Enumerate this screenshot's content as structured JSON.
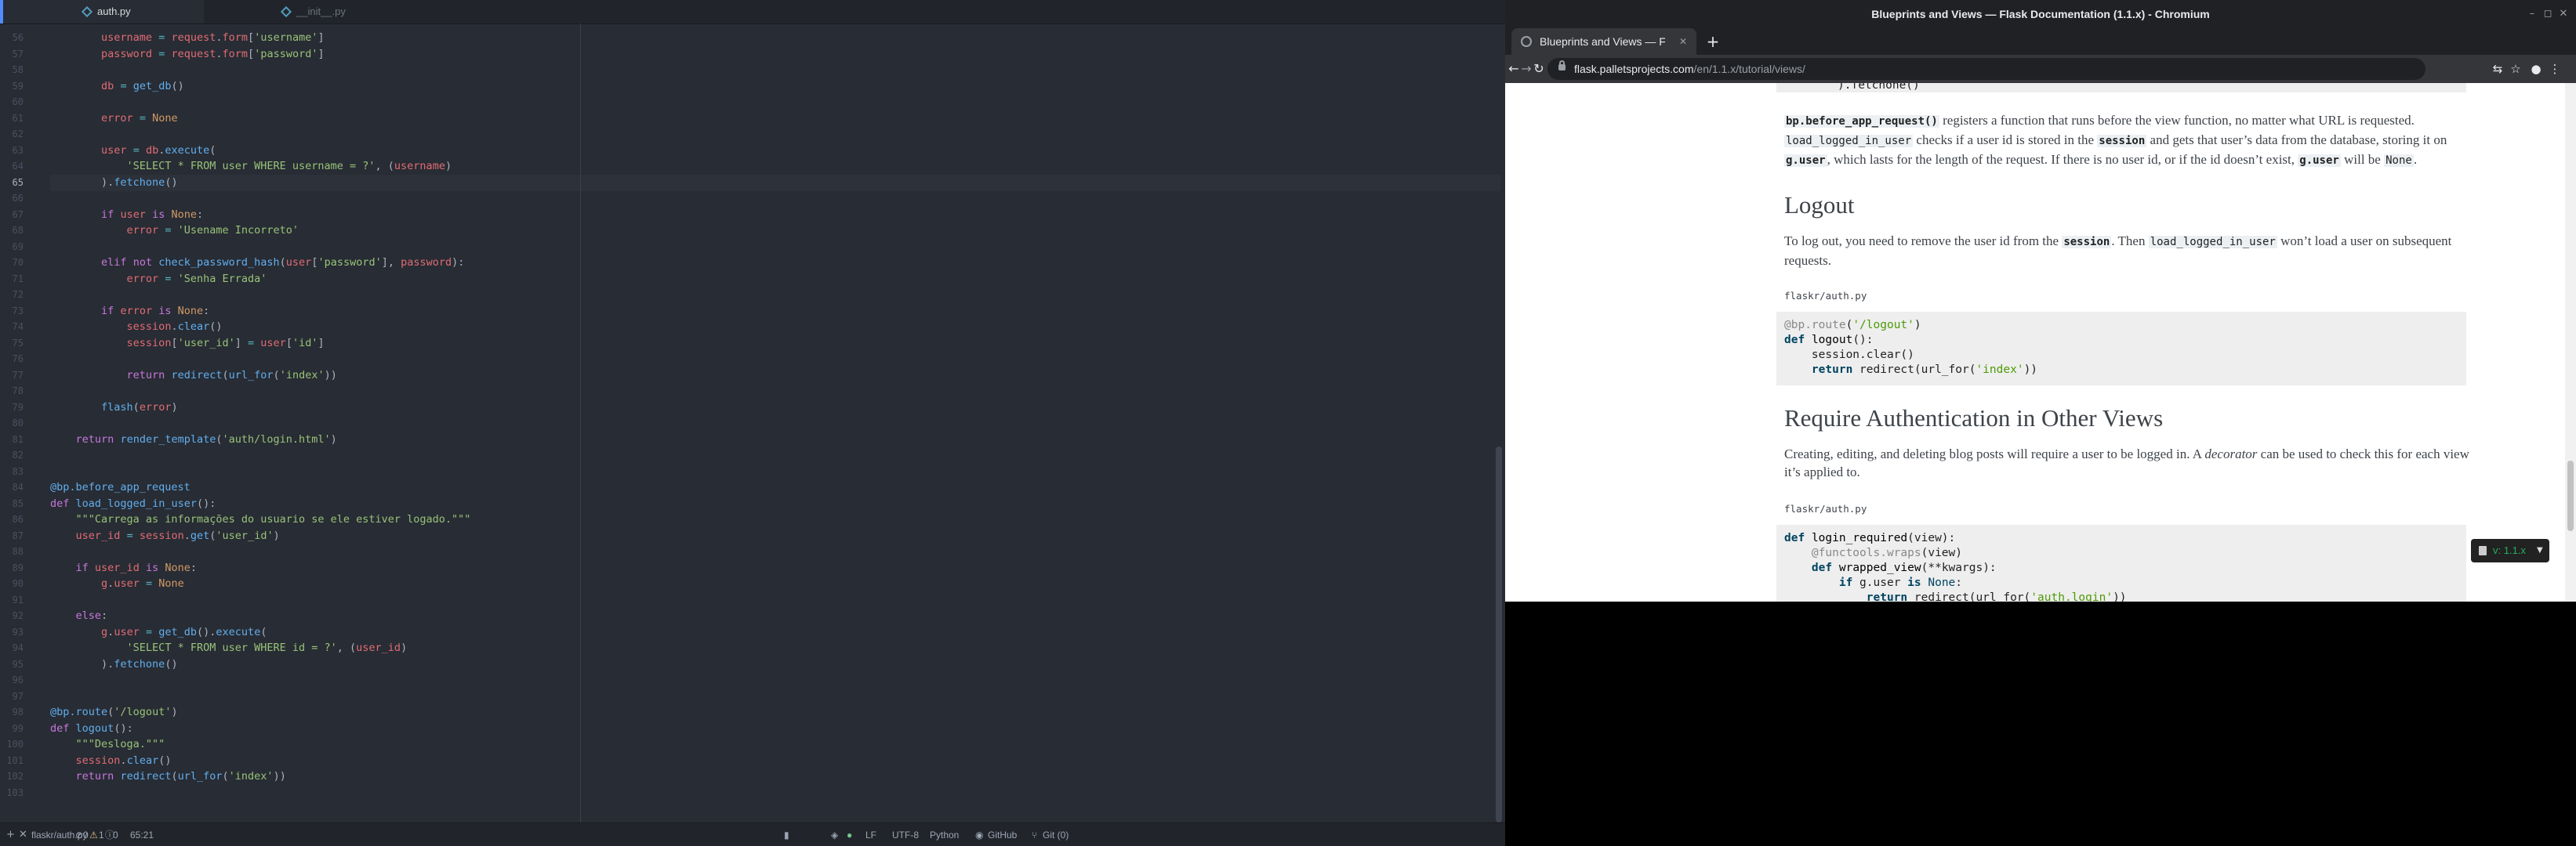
{
  "editor": {
    "tabs": [
      {
        "label": "auth.py",
        "active": true
      },
      {
        "label": "__init__.py",
        "active": false
      }
    ],
    "lines": [
      {
        "n": "56",
        "html": "        <span class=\"v\">username</span> <span class=\"o\">=</span> <span class=\"v\">request</span>.<span class=\"v\">form</span>[<span class=\"s\">'username'</span>]"
      },
      {
        "n": "57",
        "html": "        <span class=\"v\">password</span> <span class=\"o\">=</span> <span class=\"v\">request</span>.<span class=\"v\">form</span>[<span class=\"s\">'password'</span>]"
      },
      {
        "n": "58",
        "html": ""
      },
      {
        "n": "59",
        "html": "        <span class=\"v\">db</span> <span class=\"o\">=</span> <span class=\"f\">get_db</span>()"
      },
      {
        "n": "60",
        "html": ""
      },
      {
        "n": "61",
        "html": "        <span class=\"v\">error</span> <span class=\"o\">=</span> <span class=\"n\">None</span>"
      },
      {
        "n": "62",
        "html": ""
      },
      {
        "n": "63",
        "html": "        <span class=\"v\">user</span> <span class=\"o\">=</span> <span class=\"v\">db</span>.<span class=\"f\">execute</span>("
      },
      {
        "n": "64",
        "html": "            <span class=\"s\">'SELECT * FROM user WHERE username = ?'</span>, (<span class=\"v\">username</span>)"
      },
      {
        "n": "65",
        "html": "        ).<span class=\"f\">fetchone</span>()"
      },
      {
        "n": "66",
        "html": ""
      },
      {
        "n": "67",
        "html": "        <span class=\"k\">if</span> <span class=\"v\">user</span> <span class=\"k\">is</span> <span class=\"n\">None</span>:"
      },
      {
        "n": "68",
        "html": "            <span class=\"v\">error</span> <span class=\"o\">=</span> <span class=\"s\">'Usename Incorreto'</span>"
      },
      {
        "n": "69",
        "html": ""
      },
      {
        "n": "70",
        "html": "        <span class=\"k\">elif</span> <span class=\"k\">not</span> <span class=\"f\">check_password_hash</span>(<span class=\"v\">user</span>[<span class=\"s\">'password'</span>], <span class=\"v\">password</span>):"
      },
      {
        "n": "71",
        "html": "            <span class=\"v\">error</span> <span class=\"o\">=</span> <span class=\"s\">'Senha Errada'</span>"
      },
      {
        "n": "72",
        "html": ""
      },
      {
        "n": "73",
        "html": "        <span class=\"k\">if</span> <span class=\"v\">error</span> <span class=\"k\">is</span> <span class=\"n\">None</span>:"
      },
      {
        "n": "74",
        "html": "            <span class=\"v\">session</span>.<span class=\"f\">clear</span>()"
      },
      {
        "n": "75",
        "html": "            <span class=\"v\">session</span>[<span class=\"s\">'user_id'</span>] <span class=\"o\">=</span> <span class=\"v\">user</span>[<span class=\"s\">'id'</span>]"
      },
      {
        "n": "76",
        "html": ""
      },
      {
        "n": "77",
        "html": "            <span class=\"k\">return</span> <span class=\"f\">redirect</span>(<span class=\"f\">url_for</span>(<span class=\"s\">'index'</span>))"
      },
      {
        "n": "78",
        "html": ""
      },
      {
        "n": "79",
        "html": "        <span class=\"f\">flash</span>(<span class=\"v\">error</span>)"
      },
      {
        "n": "80",
        "html": ""
      },
      {
        "n": "81",
        "html": "    <span class=\"k\">return</span> <span class=\"f\">render_template</span>(<span class=\"s\">'auth/login.html'</span>)"
      },
      {
        "n": "82",
        "html": ""
      },
      {
        "n": "83",
        "html": ""
      },
      {
        "n": "84",
        "html": "<span class=\"f\">@bp.before_app_request</span>"
      },
      {
        "n": "85",
        "html": "<span class=\"k\">def</span> <span class=\"f\">load_logged_in_user</span>():"
      },
      {
        "n": "86",
        "html": "    <span class=\"s\">\"\"\"Carrega as informações do usuario se ele estiver logado.\"\"\"</span>"
      },
      {
        "n": "87",
        "html": "    <span class=\"v\">user_id</span> <span class=\"o\">=</span> <span class=\"v\">session</span>.<span class=\"f\">get</span>(<span class=\"s\">'user_id'</span>)"
      },
      {
        "n": "88",
        "html": ""
      },
      {
        "n": "89",
        "html": "    <span class=\"k\">if</span> <span class=\"v\">user_id</span> <span class=\"k\">is</span> <span class=\"n\">None</span>:"
      },
      {
        "n": "90",
        "html": "        <span class=\"v\">g</span>.<span class=\"v\">user</span> <span class=\"o\">=</span> <span class=\"n\">None</span>"
      },
      {
        "n": "91",
        "html": ""
      },
      {
        "n": "92",
        "html": "    <span class=\"k\">else</span>:"
      },
      {
        "n": "93",
        "html": "        <span class=\"v\">g</span>.<span class=\"v\">user</span> <span class=\"o\">=</span> <span class=\"f\">get_db</span>().<span class=\"f\">execute</span>("
      },
      {
        "n": "94",
        "html": "            <span class=\"s\">'SELECT * FROM user WHERE id = ?'</span>, (<span class=\"v\">user_id</span>)"
      },
      {
        "n": "95",
        "html": "        ).<span class=\"f\">fetchone</span>()"
      },
      {
        "n": "96",
        "html": ""
      },
      {
        "n": "97",
        "html": ""
      },
      {
        "n": "98",
        "html": "<span class=\"f\">@bp.route</span>(<span class=\"s\">'/logout'</span>)"
      },
      {
        "n": "99",
        "html": "<span class=\"k\">def</span> <span class=\"f\">logout</span>():"
      },
      {
        "n": "100",
        "html": "    <span class=\"s\">\"\"\"Desloga.\"\"\"</span>"
      },
      {
        "n": "101",
        "html": "    <span class=\"v\">session</span>.<span class=\"f\">clear</span>()"
      },
      {
        "n": "102",
        "html": "    <span class=\"k\">return</span> <span class=\"f\">redirect</span>(<span class=\"f\">url_for</span>(<span class=\"s\">'index'</span>))"
      },
      {
        "n": "103",
        "html": ""
      }
    ],
    "current_line": "65"
  },
  "statusbar": {
    "file_path": "flaskr/auth.py",
    "errors": "0",
    "warnings": "1",
    "infos": "0",
    "cursor": "65:21",
    "line_ending": "LF",
    "encoding": "UTF-8",
    "grammar": "Python",
    "github": "GitHub",
    "git": "Git (0)"
  },
  "browser": {
    "window_title": "Blueprints and Views — Flask Documentation (1.1.x) - Chromium",
    "tab_title": "Blueprints and Views — F",
    "url_host": "flask.palletsprojects.com",
    "url_path": "/en/1.1.x/tutorial/views/",
    "page": {
      "top_code_tail": ").fetchone()",
      "para1_code1": "bp.before_app_request()",
      "para1_text1": " registers a function that runs before the view function, no matter what URL is requested.",
      "para1_code2": "load_logged_in_user",
      "para1_text2": " checks if a user id is stored in the ",
      "para1_code3": "session",
      "para1_text3": " and gets that user’s data from the database, storing it on",
      "para1_code4": "g.user",
      "para1_text4": ", which lasts for the length of the request. If there is no user id, or if the id doesn’t exist, ",
      "para1_code5": "g.user",
      "para1_text5": " will be ",
      "para1_code6": "None",
      "para1_text6": ".",
      "logout_heading": "Logout",
      "para2_text1": "To log out, you need to remove the user id from the ",
      "para2_code1": "session",
      "para2_text2": ". Then ",
      "para2_code2": "load_logged_in_user",
      "para2_text3": " won’t load a user on subsequent requests.",
      "caption1": "flaskr/auth.py",
      "require_heading": "Require Authentication in Other Views",
      "para3_text1": "Creating, editing, and deleting blog posts will require a user to be logged in. A ",
      "para3_em": "decorator",
      "para3_text2": " can be used to check this for each view it’s applied to.",
      "caption2": "flaskr/auth.py",
      "version": "v: 1.1.x"
    }
  },
  "colors": {
    "editor_bg": "#282c34",
    "accent": "#528bff",
    "chrome_dark": "#202124"
  }
}
